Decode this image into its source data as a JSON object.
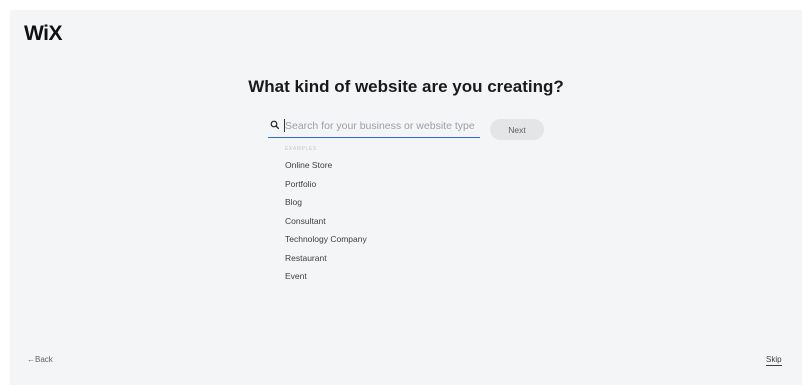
{
  "header": {
    "logo_text": "WiX"
  },
  "main": {
    "title": "What kind of website are you creating?",
    "search": {
      "placeholder": "Search for your business or website type",
      "value": "",
      "icon": "search-icon"
    },
    "next_label": "Next",
    "examples_label": "EXAMPLES",
    "examples": [
      "Online Store",
      "Portfolio",
      "Blog",
      "Consultant",
      "Technology Company",
      "Restaurant",
      "Event"
    ]
  },
  "footer": {
    "back_label": "←Back",
    "skip_label": "Skip"
  },
  "colors": {
    "background": "#f4f5f7",
    "accent": "#2f6bd8",
    "button": "#e4e5e7"
  }
}
